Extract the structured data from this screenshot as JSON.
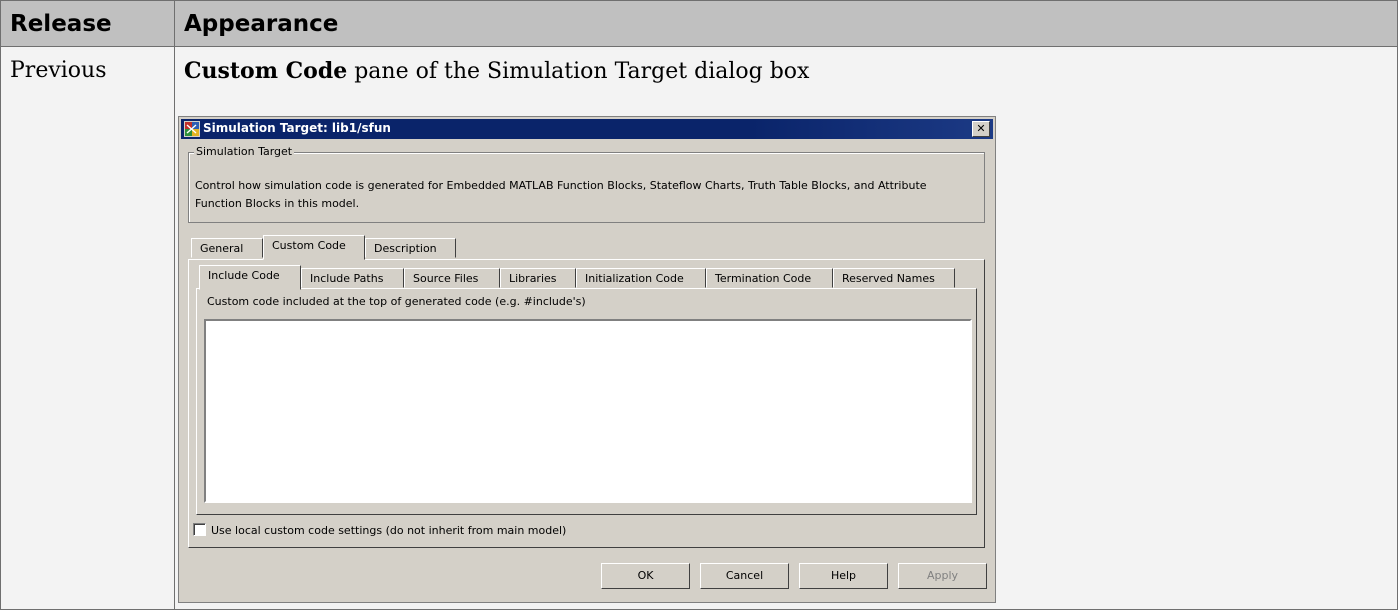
{
  "table": {
    "header": {
      "release": "Release",
      "appearance": "Appearance"
    },
    "row": {
      "release": "Previous",
      "caption_bold": "Custom Code",
      "caption_rest": " pane of the Simulation Target dialog box"
    }
  },
  "dialog": {
    "title": "Simulation Target: lib1/sfun",
    "close_glyph": "✕",
    "group_label": "Simulation Target",
    "group_text": "Control how simulation code is generated for Embedded MATLAB Function Blocks, Stateflow Charts, Truth Table Blocks, and Attribute Function Blocks in this model.",
    "tabs": [
      "General",
      "Custom Code",
      "Description"
    ],
    "selected_tab": "Custom Code",
    "subtabs": [
      "Include Code",
      "Include Paths",
      "Source Files",
      "Libraries",
      "Initialization Code",
      "Termination Code",
      "Reserved Names"
    ],
    "selected_subtab": "Include Code",
    "subtab_description": "Custom code included at the top of generated code (e.g. #include's)",
    "code_value": "",
    "checkbox_label": "Use local custom code settings (do not inherit from main model)",
    "checkbox_checked": false,
    "buttons": {
      "ok": "OK",
      "cancel": "Cancel",
      "help": "Help",
      "apply": "Apply"
    },
    "colors": {
      "title_bg": "#0a246a",
      "dialog_bg": "#d4d0c8",
      "header_bg": "#c0c0c0"
    }
  }
}
